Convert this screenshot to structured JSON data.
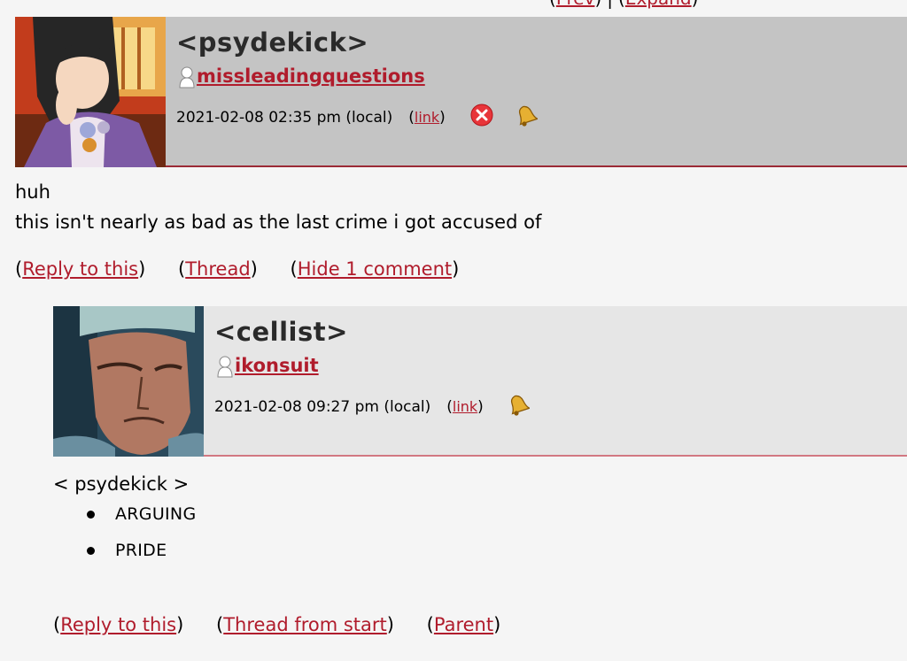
{
  "top_nav": {
    "link1": "Prev",
    "separator": "|",
    "link2": "Expand"
  },
  "comment1": {
    "poster": "<psydekick>",
    "username": "missleadingquestions",
    "date": "2021-02-08 02:35 pm (local)",
    "link_label": "link",
    "body_lines": [
      "huh",
      "this isn't nearly as bad as the last crime i got accused of"
    ],
    "actions": {
      "reply": "Reply to this",
      "thread": "Thread",
      "hide": "Hide 1 comment"
    }
  },
  "comment2": {
    "poster": "<cellist>",
    "username": "ikonsuit",
    "date": "2021-02-08 09:27 pm (local)",
    "link_label": "link",
    "body_title": "< psydekick >",
    "list_items": [
      "ARGUING",
      "PRIDE"
    ],
    "actions": {
      "reply": "Reply to this",
      "thread_start": "Thread from start",
      "parent": "Parent"
    }
  },
  "colors": {
    "link": "#b01c2c",
    "header1_bg": "#c4c4c4",
    "header2_bg": "#e6e6e6",
    "page_bg": "#f5f5f5"
  },
  "icons": {
    "user": "user-icon",
    "delete": "delete-icon",
    "track": "bell-icon"
  }
}
